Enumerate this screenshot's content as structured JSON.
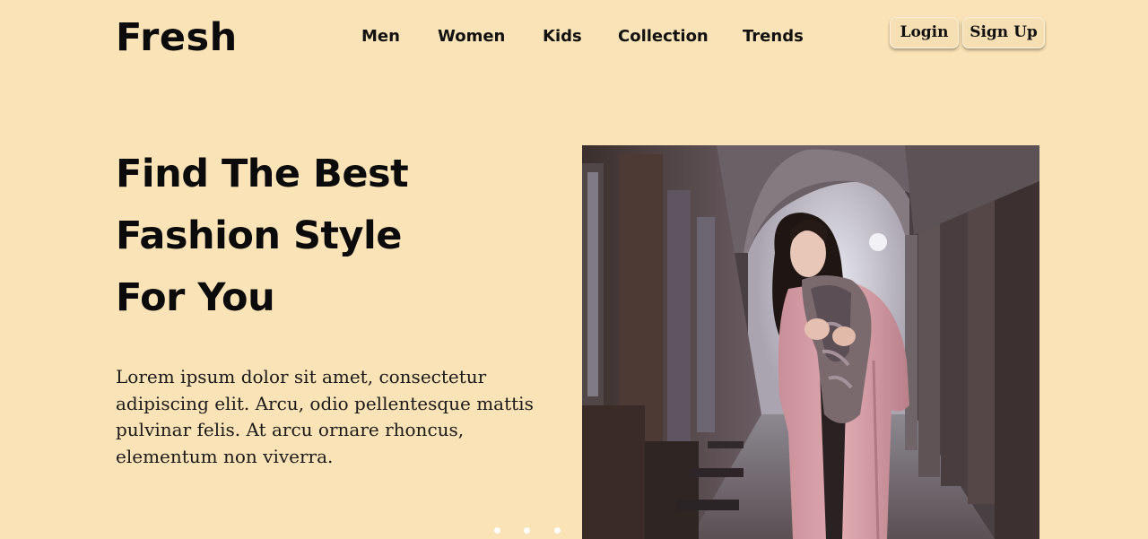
{
  "header": {
    "logo": "Fresh",
    "nav": [
      {
        "label": "Men"
      },
      {
        "label": "Women"
      },
      {
        "label": "Kids"
      },
      {
        "label": "Collection"
      },
      {
        "label": "Trends"
      }
    ],
    "login_label": "Login",
    "signup_label": "Sign Up"
  },
  "hero": {
    "title_lines": [
      "Find The Best",
      "Fashion Style",
      "For You"
    ],
    "description": "Lorem ipsum dolor sit amet, consectetur adipiscing elit. Arcu, odio pellentesque mattis pulvinar felis. At arcu ornare rhoncus, elementum non viverra.",
    "image_subject": "woman-in-pink-coat-in-arcade-photo",
    "slider_dots": 3
  },
  "colors": {
    "background": "#fae3b6",
    "text": "#0b0b0b",
    "button_bg": "#f6dfb3",
    "dot": "#ffffff"
  }
}
